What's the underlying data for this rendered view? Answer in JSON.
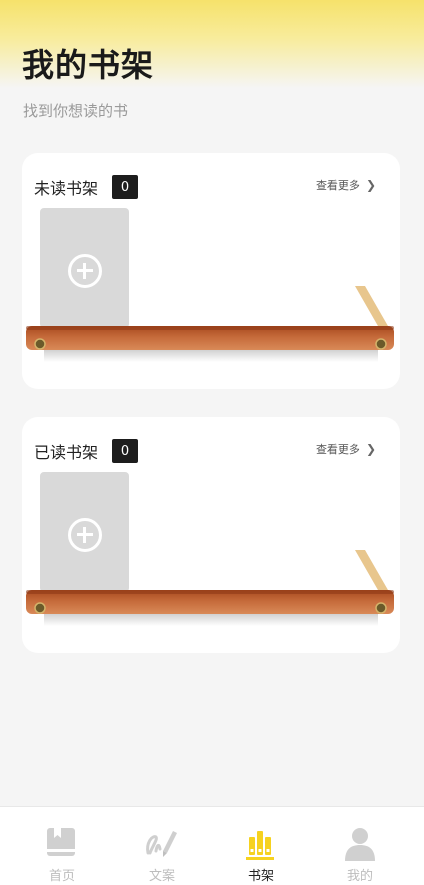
{
  "header": {
    "title": "我的书架",
    "subtitle": "找到你想读的书"
  },
  "shelves": [
    {
      "title": "未读书架",
      "count": "0",
      "more_label": "查看更多"
    },
    {
      "title": "已读书架",
      "count": "0",
      "more_label": "查看更多"
    }
  ],
  "tabs": [
    {
      "label": "首页",
      "icon": "book-icon",
      "active": false
    },
    {
      "label": "文案",
      "icon": "pen-icon",
      "active": false
    },
    {
      "label": "书架",
      "icon": "bookshelf-icon",
      "active": true
    },
    {
      "label": "我的",
      "icon": "user-icon",
      "active": false
    }
  ],
  "colors": {
    "accent": "#f6d21f",
    "header_yellow": "#f6e26b",
    "shelf_wood": "#c56a3a",
    "inactive_tab": "#bdbdbd"
  }
}
